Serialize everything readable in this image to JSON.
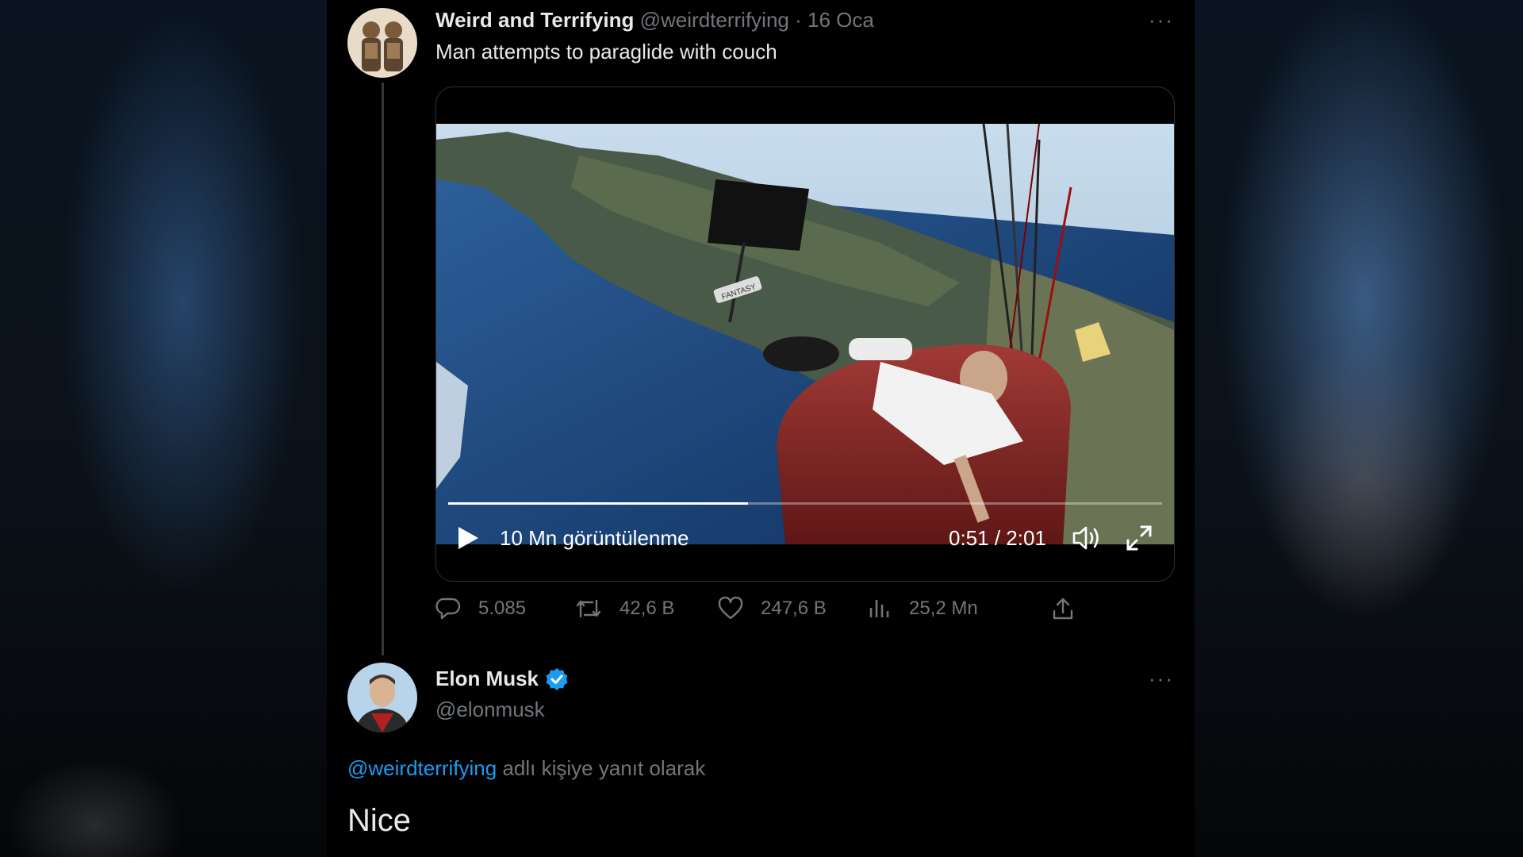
{
  "tweet": {
    "author_name": "Weird and Terrifying",
    "author_handle": "@weirdterrifying",
    "separator": "·",
    "date": "16 Oca",
    "more": "···",
    "text": "Man attempts to paraglide with couch",
    "video": {
      "views": "10 Mn görüntülenme",
      "time": "0:51 / 2:01",
      "progress": 0.42,
      "sign_text": "FANTASY"
    },
    "actions": {
      "replies": "5.085",
      "retweets": "42,6 B",
      "likes": "247,6 B",
      "views": "25,2 Mn"
    }
  },
  "reply": {
    "author_name": "Elon Musk",
    "author_handle": "@elonmusk",
    "verified": true,
    "more": "···",
    "reply_mention": "@weirdterrifying",
    "reply_suffix": " adlı kişiye yanıt olarak",
    "text": "Nice"
  },
  "colors": {
    "background": "#000000",
    "text": "#e7e9ea",
    "muted": "#71767b",
    "accent": "#1d9bf0"
  }
}
